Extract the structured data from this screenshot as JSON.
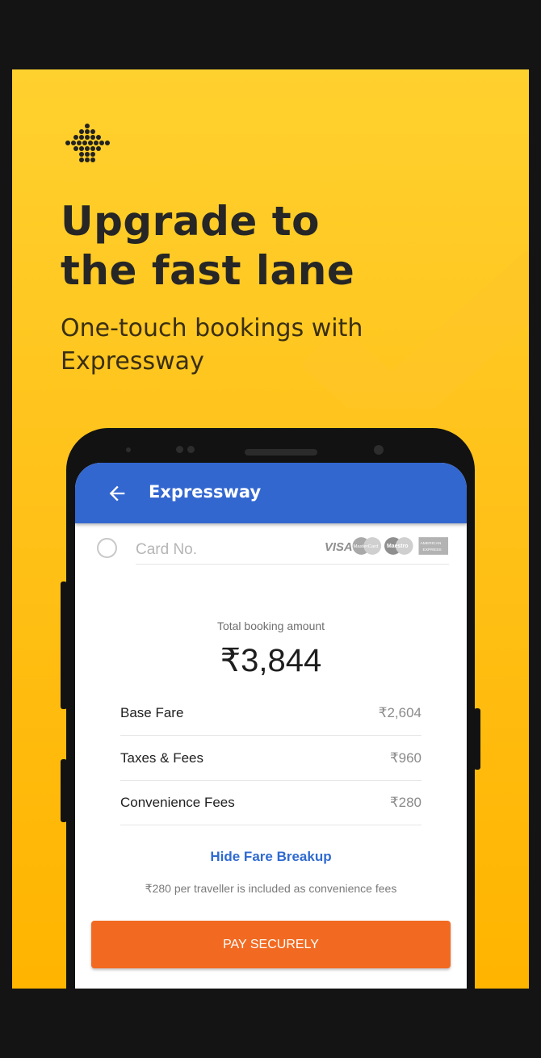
{
  "colors": {
    "banner_top": "#ffd12e",
    "banner_bottom": "#ffb400",
    "appbar": "#3367d0",
    "pay_button": "#f26a21",
    "link": "#2f6ad0"
  },
  "hero": {
    "logo_icon": "ixigo-dots-arrow-icon",
    "headline_line1": "Upgrade to",
    "headline_line2": "the fast lane",
    "subline_line1": "One-touch bookings with",
    "subline_line2": "Expressway"
  },
  "app": {
    "back_icon": "arrow-left-icon",
    "title": "Expressway",
    "card_placeholder": "Card No.",
    "card_logos": [
      "VISA",
      "MasterCard",
      "Maestro",
      "AMERICAN EXPRESS"
    ],
    "total_label": "Total booking amount",
    "total_amount": "₹3,844",
    "fares": [
      {
        "label": "Base Fare",
        "value": "₹2,604"
      },
      {
        "label": "Taxes & Fees",
        "value": "₹960"
      },
      {
        "label": "Convenience Fees",
        "value": "₹280"
      }
    ],
    "hide_fare_label": "Hide Fare Breakup",
    "note": "₹280 per traveller  is included as convenience fees",
    "pay_label": "PAY SECURELY"
  }
}
